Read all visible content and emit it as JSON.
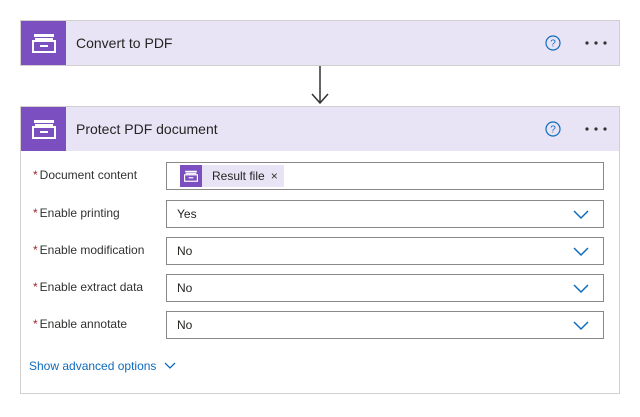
{
  "actions": [
    {
      "title": "Convert to PDF",
      "icon": "archive-box-icon"
    },
    {
      "title": "Protect PDF document",
      "icon": "archive-box-icon",
      "fields": [
        {
          "label": "Document content",
          "required": "*",
          "type": "token",
          "token_label": "Result file",
          "token_close": "×"
        },
        {
          "label": "Enable printing",
          "required": "*",
          "type": "dropdown",
          "value": "Yes"
        },
        {
          "label": "Enable modification",
          "required": "*",
          "type": "dropdown",
          "value": "No"
        },
        {
          "label": "Enable extract data",
          "required": "*",
          "type": "dropdown",
          "value": "No"
        },
        {
          "label": "Enable annotate",
          "required": "*",
          "type": "dropdown",
          "value": "No"
        }
      ],
      "advanced_label": "Show advanced options"
    }
  ],
  "colors": {
    "accent": "#7c4fc1",
    "header_bg": "#e9e4f5",
    "link": "#0f6cbd",
    "required": "#a4262c"
  }
}
